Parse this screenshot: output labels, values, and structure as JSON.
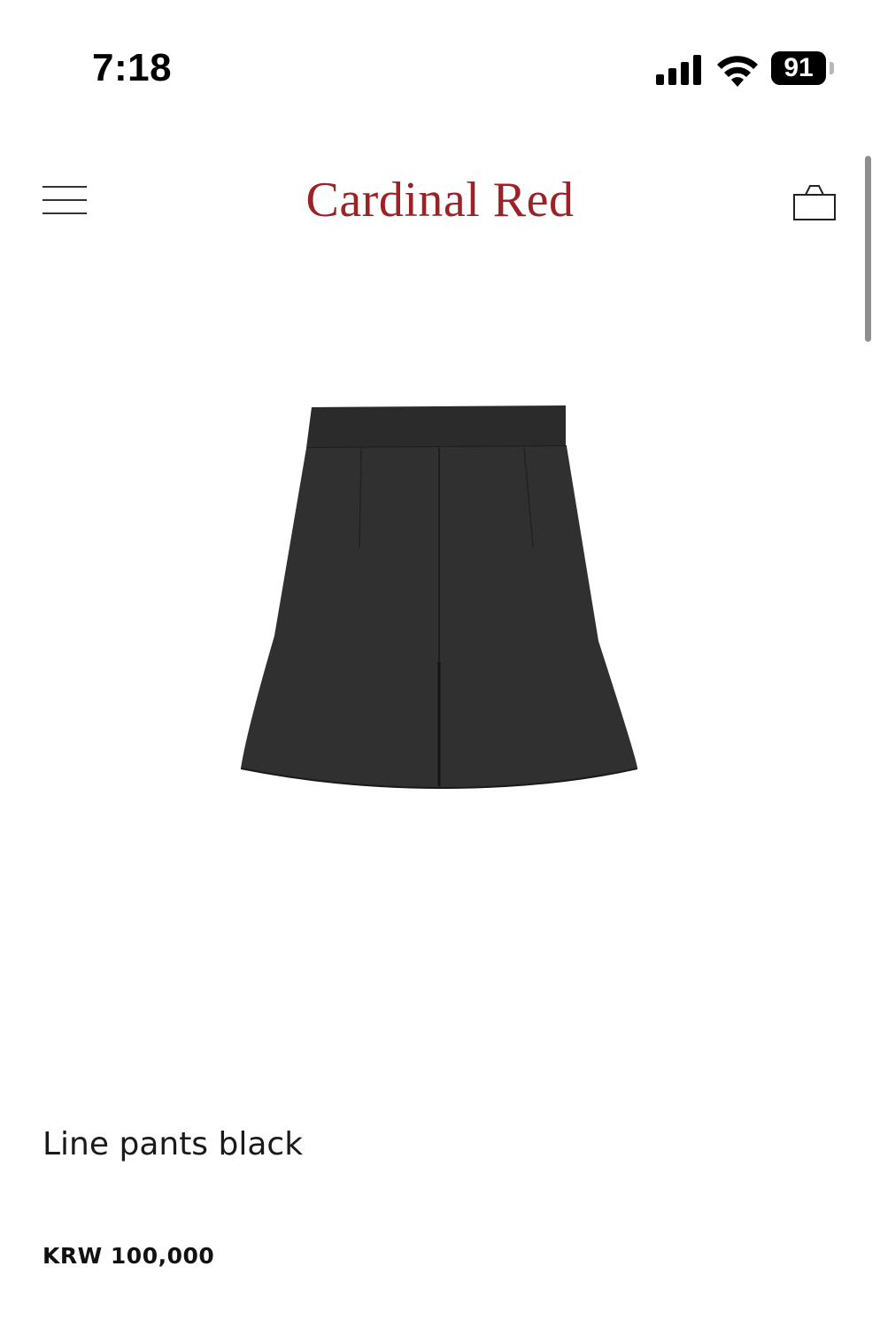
{
  "status_bar": {
    "time": "7:18",
    "battery_level": "91",
    "icons": [
      "cellular-signal-icon",
      "wifi-icon",
      "battery-icon"
    ]
  },
  "header": {
    "brand": "Cardinal Red",
    "brand_color": "#9b2227",
    "left_icon": "hamburger-menu-icon",
    "right_icon": "shopping-bag-icon"
  },
  "product": {
    "image_description": "black-a-line-shorts",
    "name": "Line pants black",
    "price": "KRW 100,000"
  },
  "colors": {
    "background": "#ffffff",
    "text": "#111111",
    "accent": "#9b2227"
  }
}
